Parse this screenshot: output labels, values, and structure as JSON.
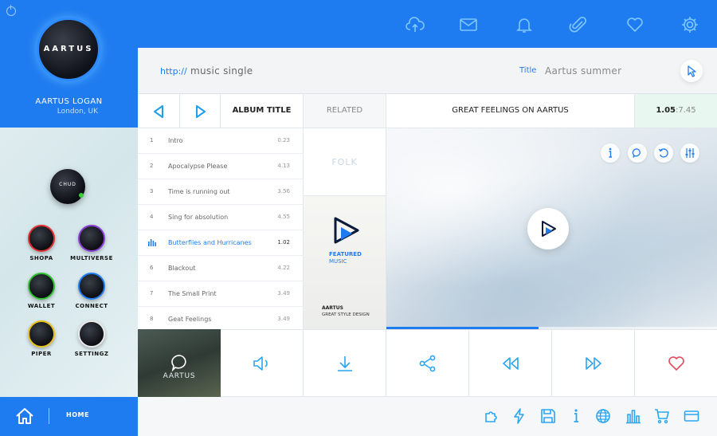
{
  "sidebar": {
    "logo_text": "AARTUS",
    "user_name": "AARTUS LOGAN",
    "user_location": "London, UK",
    "main_app_label": "CHUD",
    "apps": [
      {
        "label": "SHOPA",
        "color": "#e03030"
      },
      {
        "label": "MULTIVERSE",
        "color": "#8b3fd6"
      },
      {
        "label": "WALLET",
        "color": "#2ec02e"
      },
      {
        "label": "CONNECT",
        "color": "#1f7cf0"
      },
      {
        "label": "PIPER",
        "color": "#e8c01a"
      },
      {
        "label": "SETTINGZ",
        "color": "#e8e8e8"
      }
    ],
    "home_label": "HOME"
  },
  "topbar": {
    "icons": [
      "cloud-upload-icon",
      "mail-icon",
      "bell-icon",
      "paperclip-icon",
      "heart-icon",
      "gear-icon"
    ]
  },
  "urlbar": {
    "protocol": "http://",
    "url_value": "music single",
    "title_label": "Title",
    "title_value": "Aartus summer"
  },
  "header": {
    "album_title": "ALBUM TITLE",
    "related": "RELATED",
    "now_playing": "GREAT FEELINGS ON AARTUS",
    "time_current": "1.05",
    "time_total": ":7.45"
  },
  "tracks": [
    {
      "num": "1",
      "title": "Intro",
      "duration": "0.23"
    },
    {
      "num": "2",
      "title": "Apocalypse Please",
      "duration": "4.13"
    },
    {
      "num": "3",
      "title": "Time is running out",
      "duration": "3.56"
    },
    {
      "num": "4",
      "title": "Sing for absolution",
      "duration": "4.55"
    },
    {
      "num": "",
      "title": "Butterflies and Hurricanes",
      "duration": "1.02"
    },
    {
      "num": "6",
      "title": "Blackout",
      "duration": "4.22"
    },
    {
      "num": "7",
      "title": "The Small Print",
      "duration": "3.49"
    },
    {
      "num": "8",
      "title": "Geat Feelings",
      "duration": "3.49"
    }
  ],
  "active_track_index": 4,
  "related": {
    "folk": "FOLK",
    "featured_line1": "FEATURED",
    "featured_line2": "MUSIC",
    "featured_brand": "AARTUS",
    "featured_sub": "GREAT STYLE DESIGN"
  },
  "video": {
    "progress": 0.46
  },
  "controls": {
    "thumb_label": "AARTUS"
  },
  "bottombar": {
    "icons": [
      "puzzle-icon",
      "lightning-icon",
      "save-icon",
      "info-icon",
      "globe-icon",
      "bar-chart-icon",
      "cart-icon",
      "credit-card-icon"
    ]
  },
  "colors": {
    "accent": "#1f7cf0",
    "heart": "#e04b5e"
  }
}
